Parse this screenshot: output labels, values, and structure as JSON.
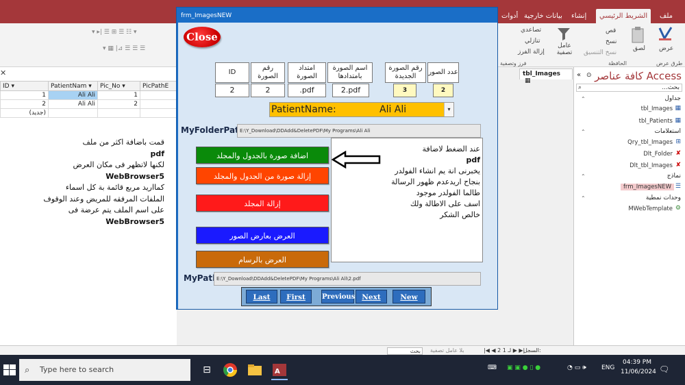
{
  "ribbon": {
    "tabs": [
      "ملف",
      "الشريط الرئيسي",
      "إنشاء",
      "بيانات خارجية",
      "أدوات"
    ],
    "active_tab": "الشريط الرئيسي",
    "view_label": "عرض",
    "group_views": "طرق عرض",
    "paste_label": "لصق",
    "cut_label": "قص",
    "copy_label": "نسخ",
    "format_painter_label": "نسخ التنسيق",
    "group_clipboard": "الحافظة",
    "filter_label": "عامل تصفية",
    "ascending_label": "تصاعدي",
    "descending_label": "تنازلي",
    "remove_sort_label": "إزالة الفرز",
    "group_sort_filter": "فرز وتصفية"
  },
  "datasheet": {
    "headers": [
      "ID",
      "PatientNam",
      "Pic_No",
      "PicPathE"
    ],
    "rows": [
      {
        "id": "1",
        "name": "Ali Ali",
        "pic_no": "1"
      },
      {
        "id": "2",
        "name": "Ali Ali",
        "pic_no": "2"
      }
    ],
    "new_row": "(جديد)"
  },
  "left_note": {
    "line1": "قمت باضافة اكثر من ملف",
    "line2": "pdf",
    "line3": "لكنها لاتظهر فى مكان العرض",
    "line4": "WebBrowser5",
    "line5": "كمااريد مربع قائمة بة كل اسماء",
    "line6": "الملفات المرفقه للمريض وعند الوقوف",
    "line7": "على اسم الملف يتم عرضة فى",
    "line8": "WebBrowser5"
  },
  "navpane": {
    "title": "كافة عناصر Access",
    "search_placeholder": "بحث...",
    "groups": {
      "tables": "جداول",
      "queries": "استعلامات",
      "forms": "نماذج",
      "modules": "وحدات نمطية"
    },
    "items": {
      "tbl_images": "tbl_Images",
      "tbl_patients": "tbl_Patients",
      "qry_images": "Qry_tbl_Images",
      "dlt_folder": "Dlt_Folder",
      "dlt_images": "Dlt_tbl_Images",
      "frm_images": "frm_ImagesNEW",
      "mweb": "MWebTemplate"
    }
  },
  "doc_tab": "tbl_Images",
  "form": {
    "title": "frm_ImagesNEW",
    "close_label": "Close",
    "headers": {
      "id": "ID",
      "pic_no": "رقم الصورة",
      "ext": "امتداد الصورة",
      "name_ext": "اسم الصورة بامتدادها",
      "new_no": "رقم الصورة الجديدة",
      "count": "عدد الصور"
    },
    "values": {
      "id": "2",
      "pic_no": "2",
      "ext": ".pdf",
      "name_ext": "2.pdf",
      "new_no": "3",
      "count": "2"
    },
    "patient_label": "PatientName:",
    "patient_value": "Ali Ali",
    "folder_label": "MyFolderPath",
    "folder_value": "E:\\Y_Download\\DDAdd&DeletePDF\\My Programs\\Ali Ali",
    "path_label": "MyPath",
    "path_value": "E:\\Y_Download\\DDAdd&DeletePDF\\My Programs\\Ali Ali\\2.pdf",
    "buttons": {
      "add": "اضافة صورة بالجدول والمجلد",
      "remove": "إزالة صورة من الجدول والمجلد",
      "remove_folder": "إزالة المجلد",
      "viewer": "العرض بعارض الصور",
      "paint": "العرض بالرسام"
    },
    "note": {
      "line1": "عند الضغط لاضافة",
      "line2": "pdf",
      "line3": "يخبرنى انة يم انشاء الفولدر",
      "line4": "بنجاح اريدعدم ظهور الرسالة",
      "line5": "طالما الفولدر موجود",
      "line6": "اسف على الاطالة ولك",
      "line7": "خالص الشكر"
    },
    "nav": {
      "last": "Last",
      "first": "First",
      "previous": "Previous",
      "next": "Next",
      "new": "New"
    },
    "colors": {
      "add": "#0a8a0a",
      "remove": "#ff4500",
      "remove_folder": "#ff1a1a",
      "viewer": "#1a1aff",
      "paint": "#c96a0a"
    }
  },
  "statusbar": {
    "record_label": "السجل:",
    "record_pos": "2 لـ 1",
    "no_filter": "بلا عامل تصفية",
    "search": "بحث"
  },
  "taskbar": {
    "search_placeholder": "Type here to search",
    "lang": "ENG",
    "time": "04:39 PM",
    "date": "11/06/2024"
  }
}
